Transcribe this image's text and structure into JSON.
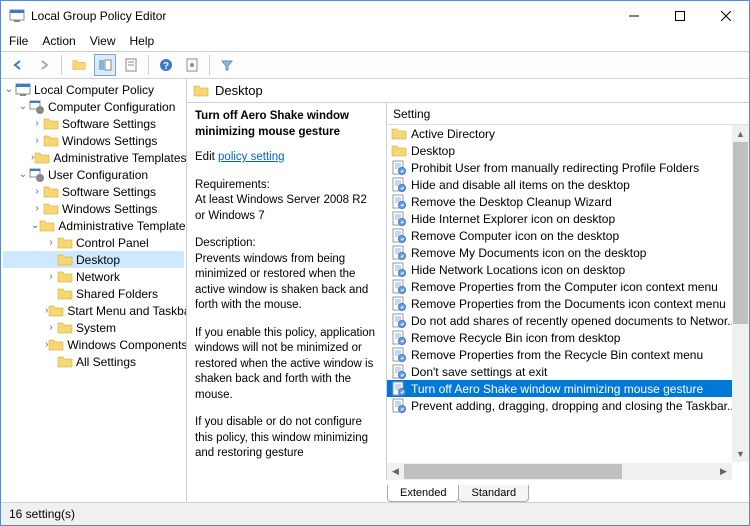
{
  "window": {
    "title": "Local Group Policy Editor"
  },
  "menubar": [
    "File",
    "Action",
    "View",
    "Help"
  ],
  "tree": {
    "root": "Local Computer Policy",
    "nodes": [
      {
        "indent": 0,
        "exp": "v",
        "icon": "gpo",
        "label": "Local Computer Policy"
      },
      {
        "indent": 1,
        "exp": "v",
        "icon": "cfg",
        "label": "Computer Configuration"
      },
      {
        "indent": 2,
        "exp": ">",
        "icon": "folder",
        "label": "Software Settings"
      },
      {
        "indent": 2,
        "exp": ">",
        "icon": "folder",
        "label": "Windows Settings"
      },
      {
        "indent": 2,
        "exp": ">",
        "icon": "folder",
        "label": "Administrative Templates"
      },
      {
        "indent": 1,
        "exp": "v",
        "icon": "cfg",
        "label": "User Configuration"
      },
      {
        "indent": 2,
        "exp": ">",
        "icon": "folder",
        "label": "Software Settings"
      },
      {
        "indent": 2,
        "exp": ">",
        "icon": "folder",
        "label": "Windows Settings"
      },
      {
        "indent": 2,
        "exp": "v",
        "icon": "folder",
        "label": "Administrative Templates"
      },
      {
        "indent": 3,
        "exp": ">",
        "icon": "folder",
        "label": "Control Panel"
      },
      {
        "indent": 3,
        "exp": "",
        "icon": "folder",
        "label": "Desktop",
        "selected": true
      },
      {
        "indent": 3,
        "exp": ">",
        "icon": "folder",
        "label": "Network"
      },
      {
        "indent": 3,
        "exp": "",
        "icon": "folder",
        "label": "Shared Folders"
      },
      {
        "indent": 3,
        "exp": ">",
        "icon": "folder",
        "label": "Start Menu and Taskbar"
      },
      {
        "indent": 3,
        "exp": ">",
        "icon": "folder",
        "label": "System"
      },
      {
        "indent": 3,
        "exp": ">",
        "icon": "folder",
        "label": "Windows Components"
      },
      {
        "indent": 3,
        "exp": "",
        "icon": "folder",
        "label": "All Settings"
      }
    ]
  },
  "detail": {
    "header": "Desktop",
    "policy_title": "Turn off Aero Shake window minimizing mouse gesture",
    "edit_label": "Edit",
    "edit_link": "policy setting",
    "req_label": "Requirements:",
    "req_text": "At least Windows Server 2008 R2 or Windows 7",
    "desc_label": "Description:",
    "desc_p1": "Prevents windows from being minimized or restored when the active window is shaken back and forth with the mouse.",
    "desc_p2": "If you enable this policy, application windows will not be minimized or restored when the active window is shaken back and forth with the mouse.",
    "desc_p3": "If you disable or do not configure this policy, this window minimizing and restoring gesture"
  },
  "list": {
    "column": "Setting",
    "rows": [
      {
        "icon": "folder",
        "label": "Active Directory"
      },
      {
        "icon": "folder",
        "label": "Desktop"
      },
      {
        "icon": "policy",
        "label": "Prohibit User from manually redirecting Profile Folders"
      },
      {
        "icon": "policy",
        "label": "Hide and disable all items on the desktop"
      },
      {
        "icon": "policy",
        "label": "Remove the Desktop Cleanup Wizard"
      },
      {
        "icon": "policy",
        "label": "Hide Internet Explorer icon on desktop"
      },
      {
        "icon": "policy",
        "label": "Remove Computer icon on the desktop"
      },
      {
        "icon": "policy",
        "label": "Remove My Documents icon on the desktop"
      },
      {
        "icon": "policy",
        "label": "Hide Network Locations icon on desktop"
      },
      {
        "icon": "policy",
        "label": "Remove Properties from the Computer icon context menu"
      },
      {
        "icon": "policy",
        "label": "Remove Properties from the Documents icon context menu"
      },
      {
        "icon": "policy",
        "label": "Do not add shares of recently opened documents to Networ..."
      },
      {
        "icon": "policy",
        "label": "Remove Recycle Bin icon from desktop"
      },
      {
        "icon": "policy",
        "label": "Remove Properties from the Recycle Bin context menu"
      },
      {
        "icon": "policy",
        "label": "Don't save settings at exit"
      },
      {
        "icon": "policy",
        "label": "Turn off Aero Shake window minimizing mouse gesture",
        "selected": true
      },
      {
        "icon": "policy",
        "label": "Prevent adding, dragging, dropping and closing the Taskbar..."
      }
    ]
  },
  "tabs": {
    "extended": "Extended",
    "standard": "Standard"
  },
  "status": "16 setting(s)"
}
